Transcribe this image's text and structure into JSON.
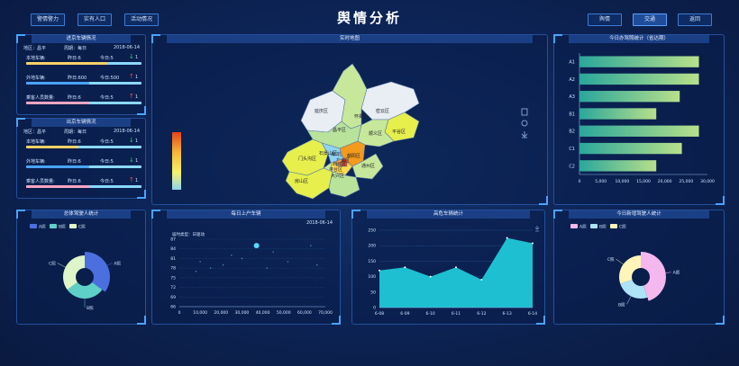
{
  "header": {
    "title": "舆情分析",
    "nav_left": [
      "警情警力",
      "实有人口",
      "活动情况"
    ],
    "nav_right": [
      "舆情",
      "交通",
      "返回"
    ],
    "active_nav": "交通"
  },
  "enter": {
    "title": "进京车辆情况",
    "region_label": "地区：",
    "region_value": "昌平",
    "period_label": "周期：",
    "period_value": "每日",
    "date": "2018-06-14",
    "rows": [
      {
        "label": "本地车辆:",
        "yesterday": "昨日:6",
        "today": "今日:5",
        "change": "1",
        "dir": "up",
        "fill": 0.7,
        "color": "#f7d266"
      },
      {
        "label": "外地车辆:",
        "yesterday": "昨日:600",
        "today": "今日:500",
        "change": "1",
        "dir": "down",
        "fill": 0.55,
        "color": "#4aa3ff"
      },
      {
        "label": "乘客人员数量:",
        "yesterday": "昨日:6",
        "today": "今日:5",
        "change": "1",
        "dir": "down",
        "fill": 0.55,
        "color": "#f8a5c2"
      }
    ]
  },
  "exit": {
    "title": "出京车辆情况",
    "region_label": "地区：",
    "region_value": "昌平",
    "period_label": "周期：",
    "period_value": "每日",
    "date": "2018-06-14",
    "rows": [
      {
        "label": "本地车辆:",
        "yesterday": "昨日:6",
        "today": "今日:5",
        "change": "1",
        "dir": "up",
        "fill": 0.45,
        "color": "#f7d266"
      },
      {
        "label": "外地车辆:",
        "yesterday": "昨日:6",
        "today": "今日:5",
        "change": "1",
        "dir": "up",
        "fill": 0.55,
        "color": "#4aa3ff"
      },
      {
        "label": "乘客人员数量:",
        "yesterday": "昨日:6",
        "today": "今日:5",
        "change": "1",
        "dir": "down",
        "fill": 0.55,
        "color": "#f8a5c2"
      }
    ]
  },
  "map": {
    "title": "实时地图",
    "districts": [
      "延庆区",
      "怀柔区",
      "密云区",
      "昌平区",
      "平谷区",
      "顺义区",
      "门头沟区",
      "海淀区",
      "朝阳区",
      "石景山区",
      "丰台区",
      "东城区",
      "西城区",
      "通州区",
      "房山区",
      "大兴区"
    ],
    "tools": [
      "download-icon",
      "refresh-icon",
      "view-icon"
    ]
  },
  "driverlic": {
    "title": "今日办驾照统计（省达期）"
  },
  "drivers": {
    "title": "总体驾驶人统计"
  },
  "newdrivers": {
    "title": "今日新增驾驶人统计"
  },
  "onroad": {
    "title": "每日上户车辆",
    "date": "2018-06-14",
    "legend": "届时类型：日驱动"
  },
  "danger": {
    "title": "高危车辆统计"
  },
  "chart_data": [
    {
      "type": "bar",
      "title": "今日办驾照统计（省达期）",
      "categories": [
        "A1",
        "A2",
        "A3",
        "B1",
        "B2",
        "C1",
        "C2"
      ],
      "values": [
        28000,
        28000,
        23500,
        18000,
        28000,
        24000,
        18000
      ],
      "xlim": [
        0,
        30000
      ],
      "xticks": [
        "0",
        "5,000",
        "10,000",
        "15,000",
        "20,000",
        "25,000",
        "30,000"
      ]
    },
    {
      "type": "pie",
      "title": "总体驾驶人统计",
      "legend": [
        "A照",
        "B照",
        "C照"
      ],
      "values": [
        35,
        30,
        35
      ],
      "colors": [
        "#4c6fe0",
        "#5fd0c8",
        "#ddf5c8"
      ]
    },
    {
      "type": "pie",
      "title": "今日新增驾驶人统计",
      "legend": [
        "A照",
        "B照",
        "C照"
      ],
      "values": [
        45,
        25,
        30
      ],
      "colors": [
        "#f4b8ee",
        "#aee3f7",
        "#fff5b8"
      ]
    },
    {
      "type": "scatter",
      "title": "每日上户车辆",
      "yticks": [
        "66",
        "69",
        "72",
        "75",
        "78",
        "81",
        "84",
        "87"
      ],
      "xticks": [
        "0",
        "10,000",
        "20,000",
        "30,000",
        "40,000",
        "50,000",
        "60,000",
        "70,000"
      ],
      "xlim": [
        0,
        70000
      ],
      "ylim": [
        66,
        87
      ],
      "points": [
        [
          37000,
          85
        ],
        [
          63000,
          85
        ],
        [
          45000,
          83
        ],
        [
          30000,
          81
        ],
        [
          21000,
          79
        ],
        [
          8000,
          77
        ],
        [
          15000,
          78
        ],
        [
          52000,
          80
        ],
        [
          25000,
          82
        ],
        [
          66000,
          79
        ],
        [
          10000,
          80
        ],
        [
          42000,
          78
        ]
      ]
    },
    {
      "type": "area",
      "title": "高危车辆统计",
      "categories": [
        "6-08",
        "6-09",
        "6-10",
        "6-11",
        "6-12",
        "6-13",
        "6-14"
      ],
      "values": [
        120,
        130,
        100,
        130,
        90,
        225,
        208
      ],
      "ylim": [
        0,
        250
      ],
      "yticks": [
        "0",
        "50",
        "100",
        "150",
        "200",
        "250"
      ]
    }
  ]
}
